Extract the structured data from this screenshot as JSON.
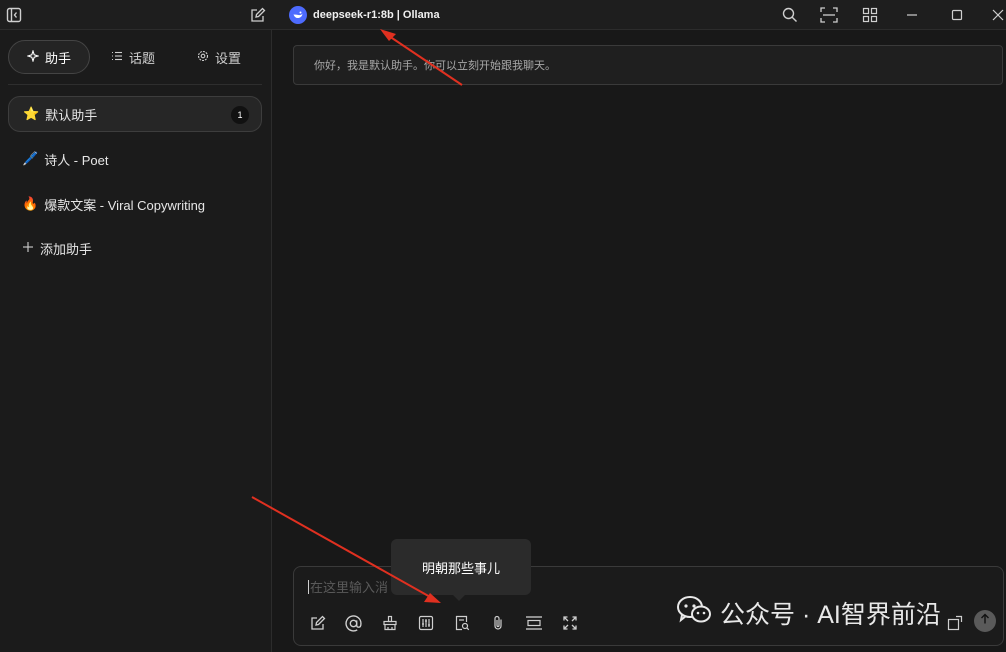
{
  "titlebar": {
    "model_name": "deepseek-r1:8b | Ollama",
    "icons": [
      "sidebar-toggle-icon",
      "new-chat-icon",
      "search-icon",
      "screen-capture-icon",
      "apps-grid-icon",
      "minimize-icon",
      "maximize-icon",
      "close-icon"
    ]
  },
  "sidebar": {
    "tabs": [
      {
        "label": "助手",
        "icon": "sparkle-icon",
        "active": true
      },
      {
        "label": "话题",
        "icon": "list-icon",
        "active": false
      },
      {
        "label": "设置",
        "icon": "gear-icon",
        "active": false
      }
    ],
    "assistants": [
      {
        "emoji": "⭐",
        "label": "默认助手",
        "count": "1",
        "active": true
      },
      {
        "emoji": "🖊️",
        "label": "诗人 - Poet"
      },
      {
        "emoji": "🔥",
        "label": "爆款文案 - Viral Copywriting"
      }
    ],
    "add_label": "添加助手"
  },
  "main": {
    "greeting": "你好，我是默认助手。你可以立刻开始跟我聊天。",
    "input_placeholder": "在这里输入消",
    "tooltip": "明朝那些事儿",
    "toolbar_icons": [
      "new-topic-icon",
      "mention-icon",
      "clear-icon",
      "settings-sliders-icon",
      "web-search-icon",
      "attachment-icon",
      "layout-icon",
      "expand-icon"
    ]
  },
  "watermark": "公众号 · AI智界前沿",
  "colors": {
    "background": "#181818",
    "accent": "#4d6bfe",
    "annotation_arrow": "#e03020"
  }
}
